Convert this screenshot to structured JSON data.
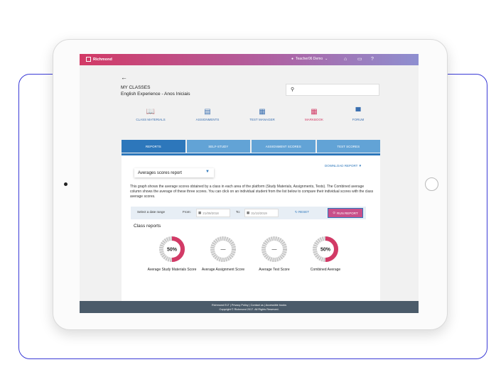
{
  "topbar": {
    "brand": "Richmond",
    "user": "Teacher06 Demo",
    "user_caret": "⌄",
    "home_icon": "⌂",
    "message_icon": "▭",
    "help_icon": "?"
  },
  "header": {
    "back_arrow": "←",
    "title": "MY CLASSES",
    "class_name": "English Experience - Anos Iniciais",
    "search_icon": "⚲"
  },
  "nav": [
    {
      "label": "CLASS MATERIALS",
      "icon": "book-icon",
      "glyph": "📖"
    },
    {
      "label": "ASSIGNMENTS",
      "icon": "document-icon",
      "glyph": "▤"
    },
    {
      "label": "TEST MANAGER",
      "icon": "test-icon",
      "glyph": "▦"
    },
    {
      "label": "MARKBOOK",
      "icon": "markbook-icon",
      "glyph": "▦"
    },
    {
      "label": "FORUM",
      "icon": "chat-icon",
      "glyph": "▀"
    }
  ],
  "tabs": [
    "REPORTS",
    "SELF-STUDY",
    "ASSIGNMENT SCORES",
    "TEST SCORES"
  ],
  "report": {
    "select_value": "Averages scores report",
    "select_caret": "▼",
    "download": "DOWNLOAD REPORT ▼",
    "description": "This graph shows the average scores obtained by a class in each area of the platform (Study Materials, Assignments, Tests). The Combined average column shows the average of these three scores. You can click on an individual student from the list below to compare their individual scores with the class average scores.",
    "filter": {
      "label": "Select a date range",
      "from_label": "From:",
      "from_value": "21/09/2018",
      "to_label": "To:",
      "to_value": "31/10/2019",
      "reset": "RESET",
      "reset_icon": "↻",
      "run": "RUN REPORT",
      "calendar_glyph": "▦",
      "run_glyph": "⊙"
    },
    "class_reports_title": "Class reports",
    "scores": [
      {
        "label": "Average Study Materials Score",
        "value": "50%",
        "fraction": 0.5
      },
      {
        "label": "Average Assignment Score",
        "value": "—",
        "fraction": 0
      },
      {
        "label": "Average Test Score",
        "value": "—",
        "fraction": 0
      },
      {
        "label": "Combined Average",
        "value": "50%",
        "fraction": 0.5
      }
    ]
  },
  "footer": {
    "links": "Richmond ELT  |  Privacy Policy  |  Contact us  |  Accessible books",
    "copyright": "Copyright © Richmond 2017. All Rights Reserved."
  },
  "colors": {
    "accent_blue": "#2d77bb",
    "accent_pink": "#d23a66",
    "donut_gray": "#c8c8c8"
  }
}
